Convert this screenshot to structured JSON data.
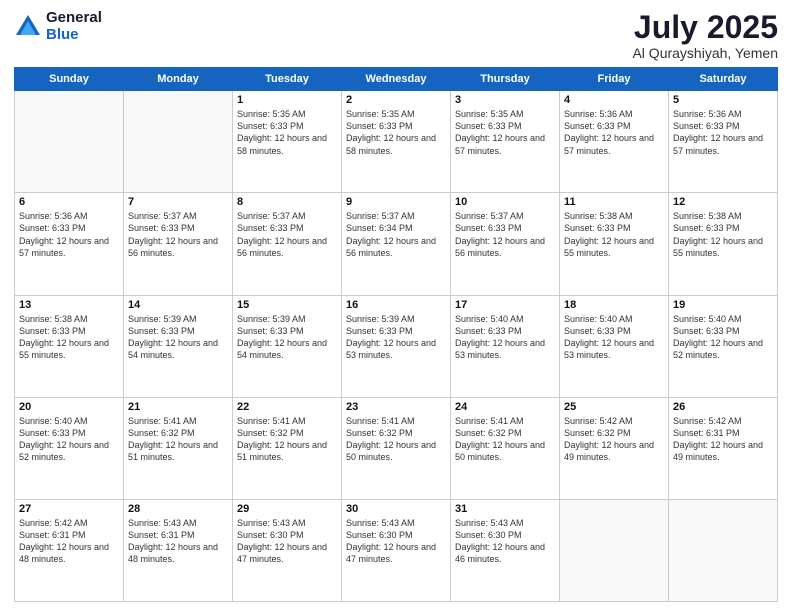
{
  "logo": {
    "general": "General",
    "blue": "Blue"
  },
  "title": {
    "month": "July 2025",
    "location": "Al Qurayshiyah, Yemen"
  },
  "weekdays": [
    "Sunday",
    "Monday",
    "Tuesday",
    "Wednesday",
    "Thursday",
    "Friday",
    "Saturday"
  ],
  "weeks": [
    [
      {
        "day": "",
        "detail": ""
      },
      {
        "day": "",
        "detail": ""
      },
      {
        "day": "1",
        "detail": "Sunrise: 5:35 AM\nSunset: 6:33 PM\nDaylight: 12 hours\nand 58 minutes."
      },
      {
        "day": "2",
        "detail": "Sunrise: 5:35 AM\nSunset: 6:33 PM\nDaylight: 12 hours\nand 58 minutes."
      },
      {
        "day": "3",
        "detail": "Sunrise: 5:35 AM\nSunset: 6:33 PM\nDaylight: 12 hours\nand 57 minutes."
      },
      {
        "day": "4",
        "detail": "Sunrise: 5:36 AM\nSunset: 6:33 PM\nDaylight: 12 hours\nand 57 minutes."
      },
      {
        "day": "5",
        "detail": "Sunrise: 5:36 AM\nSunset: 6:33 PM\nDaylight: 12 hours\nand 57 minutes."
      }
    ],
    [
      {
        "day": "6",
        "detail": "Sunrise: 5:36 AM\nSunset: 6:33 PM\nDaylight: 12 hours\nand 57 minutes."
      },
      {
        "day": "7",
        "detail": "Sunrise: 5:37 AM\nSunset: 6:33 PM\nDaylight: 12 hours\nand 56 minutes."
      },
      {
        "day": "8",
        "detail": "Sunrise: 5:37 AM\nSunset: 6:33 PM\nDaylight: 12 hours\nand 56 minutes."
      },
      {
        "day": "9",
        "detail": "Sunrise: 5:37 AM\nSunset: 6:34 PM\nDaylight: 12 hours\nand 56 minutes."
      },
      {
        "day": "10",
        "detail": "Sunrise: 5:37 AM\nSunset: 6:33 PM\nDaylight: 12 hours\nand 56 minutes."
      },
      {
        "day": "11",
        "detail": "Sunrise: 5:38 AM\nSunset: 6:33 PM\nDaylight: 12 hours\nand 55 minutes."
      },
      {
        "day": "12",
        "detail": "Sunrise: 5:38 AM\nSunset: 6:33 PM\nDaylight: 12 hours\nand 55 minutes."
      }
    ],
    [
      {
        "day": "13",
        "detail": "Sunrise: 5:38 AM\nSunset: 6:33 PM\nDaylight: 12 hours\nand 55 minutes."
      },
      {
        "day": "14",
        "detail": "Sunrise: 5:39 AM\nSunset: 6:33 PM\nDaylight: 12 hours\nand 54 minutes."
      },
      {
        "day": "15",
        "detail": "Sunrise: 5:39 AM\nSunset: 6:33 PM\nDaylight: 12 hours\nand 54 minutes."
      },
      {
        "day": "16",
        "detail": "Sunrise: 5:39 AM\nSunset: 6:33 PM\nDaylight: 12 hours\nand 53 minutes."
      },
      {
        "day": "17",
        "detail": "Sunrise: 5:40 AM\nSunset: 6:33 PM\nDaylight: 12 hours\nand 53 minutes."
      },
      {
        "day": "18",
        "detail": "Sunrise: 5:40 AM\nSunset: 6:33 PM\nDaylight: 12 hours\nand 53 minutes."
      },
      {
        "day": "19",
        "detail": "Sunrise: 5:40 AM\nSunset: 6:33 PM\nDaylight: 12 hours\nand 52 minutes."
      }
    ],
    [
      {
        "day": "20",
        "detail": "Sunrise: 5:40 AM\nSunset: 6:33 PM\nDaylight: 12 hours\nand 52 minutes."
      },
      {
        "day": "21",
        "detail": "Sunrise: 5:41 AM\nSunset: 6:32 PM\nDaylight: 12 hours\nand 51 minutes."
      },
      {
        "day": "22",
        "detail": "Sunrise: 5:41 AM\nSunset: 6:32 PM\nDaylight: 12 hours\nand 51 minutes."
      },
      {
        "day": "23",
        "detail": "Sunrise: 5:41 AM\nSunset: 6:32 PM\nDaylight: 12 hours\nand 50 minutes."
      },
      {
        "day": "24",
        "detail": "Sunrise: 5:41 AM\nSunset: 6:32 PM\nDaylight: 12 hours\nand 50 minutes."
      },
      {
        "day": "25",
        "detail": "Sunrise: 5:42 AM\nSunset: 6:32 PM\nDaylight: 12 hours\nand 49 minutes."
      },
      {
        "day": "26",
        "detail": "Sunrise: 5:42 AM\nSunset: 6:31 PM\nDaylight: 12 hours\nand 49 minutes."
      }
    ],
    [
      {
        "day": "27",
        "detail": "Sunrise: 5:42 AM\nSunset: 6:31 PM\nDaylight: 12 hours\nand 48 minutes."
      },
      {
        "day": "28",
        "detail": "Sunrise: 5:43 AM\nSunset: 6:31 PM\nDaylight: 12 hours\nand 48 minutes."
      },
      {
        "day": "29",
        "detail": "Sunrise: 5:43 AM\nSunset: 6:30 PM\nDaylight: 12 hours\nand 47 minutes."
      },
      {
        "day": "30",
        "detail": "Sunrise: 5:43 AM\nSunset: 6:30 PM\nDaylight: 12 hours\nand 47 minutes."
      },
      {
        "day": "31",
        "detail": "Sunrise: 5:43 AM\nSunset: 6:30 PM\nDaylight: 12 hours\nand 46 minutes."
      },
      {
        "day": "",
        "detail": ""
      },
      {
        "day": "",
        "detail": ""
      }
    ]
  ]
}
